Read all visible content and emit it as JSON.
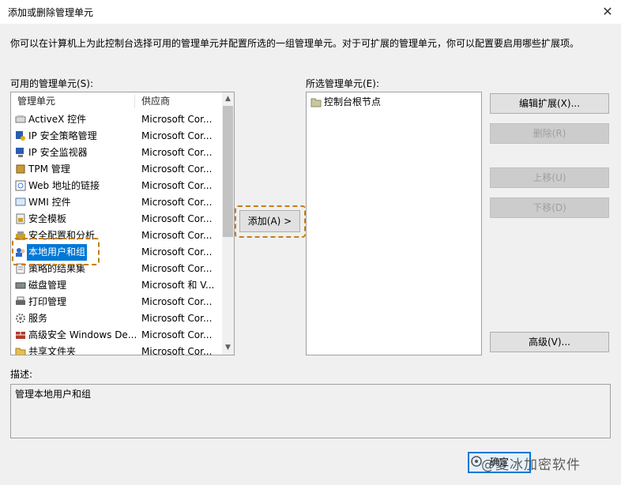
{
  "window": {
    "title": "添加或删除管理单元",
    "close_glyph": "✕"
  },
  "intro_text": "你可以在计算机上为此控制台选择可用的管理单元并配置所选的一组管理单元。对于可扩展的管理单元，你可以配置要启用哪些扩展项。",
  "available": {
    "label": "可用的管理单元(S):",
    "columns": {
      "name": "管理单元",
      "vendor": "供应商"
    },
    "items": [
      {
        "name": "ActiveX 控件",
        "vendor": "Microsoft Cor...",
        "icon": "activex-icon"
      },
      {
        "name": "IP 安全策略管理",
        "vendor": "Microsoft Cor...",
        "icon": "ip-policy-icon"
      },
      {
        "name": "IP 安全监视器",
        "vendor": "Microsoft Cor...",
        "icon": "ip-monitor-icon"
      },
      {
        "name": "TPM 管理",
        "vendor": "Microsoft Cor...",
        "icon": "tpm-icon"
      },
      {
        "name": "Web 地址的链接",
        "vendor": "Microsoft Cor...",
        "icon": "web-link-icon"
      },
      {
        "name": "WMI 控件",
        "vendor": "Microsoft Cor...",
        "icon": "wmi-icon"
      },
      {
        "name": "安全模板",
        "vendor": "Microsoft Cor...",
        "icon": "security-template-icon"
      },
      {
        "name": "安全配置和分析",
        "vendor": "Microsoft Cor...",
        "icon": "security-config-icon"
      },
      {
        "name": "本地用户和组",
        "vendor": "Microsoft Cor...",
        "icon": "local-users-icon"
      },
      {
        "name": "策略的结果集",
        "vendor": "Microsoft Cor...",
        "icon": "rsop-icon"
      },
      {
        "name": "磁盘管理",
        "vendor": "Microsoft 和 V...",
        "icon": "disk-icon"
      },
      {
        "name": "打印管理",
        "vendor": "Microsoft Cor...",
        "icon": "printer-icon"
      },
      {
        "name": "服务",
        "vendor": "Microsoft Cor...",
        "icon": "gear-icon"
      },
      {
        "name": "高级安全 Windows De...",
        "vendor": "Microsoft Cor...",
        "icon": "firewall-icon"
      },
      {
        "name": "共享文件夹",
        "vendor": "Microsoft Cor...",
        "icon": "shared-folder-icon"
      }
    ],
    "selected_index": 8
  },
  "selected": {
    "label": "所选管理单元(E):",
    "items": [
      {
        "name": "控制台根节点",
        "icon": "folder-icon"
      }
    ]
  },
  "buttons": {
    "add": "添加(A) >",
    "edit_extensions": "编辑扩展(X)...",
    "remove": "删除(R)",
    "move_up": "上移(U)",
    "move_down": "下移(D)",
    "advanced": "高级(V)...",
    "ok": "确定"
  },
  "description": {
    "label": "描述:",
    "text": "管理本地用户和组"
  },
  "watermark": "@夏冰加密软件",
  "colors": {
    "accent": "#0078d7",
    "highlight_dash": "#c47e1a"
  }
}
